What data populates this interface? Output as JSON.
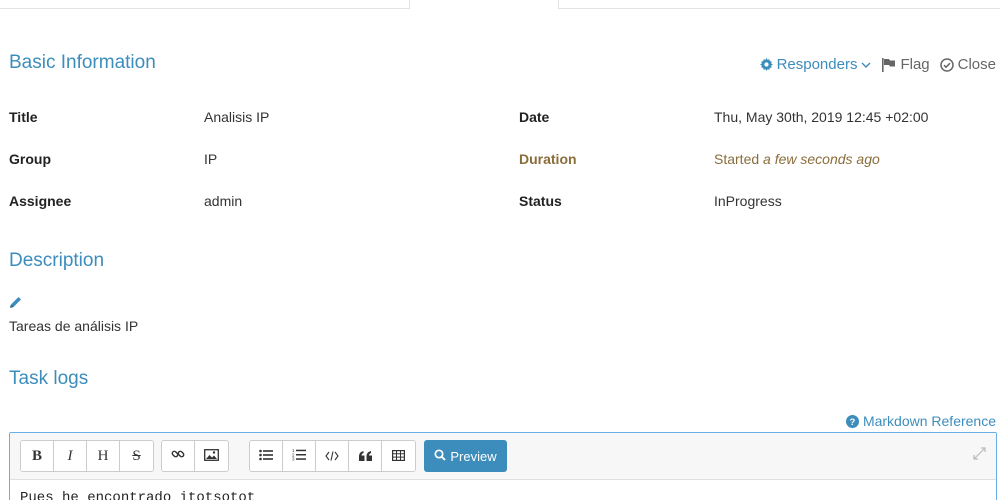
{
  "sections": {
    "basic_information": "Basic Information",
    "description": "Description",
    "task_logs": "Task logs"
  },
  "actions": {
    "responders": "Responders",
    "flag": "Flag",
    "close": "Close"
  },
  "fields": {
    "title_label": "Title",
    "title_value": "Analisis IP",
    "group_label": "Group",
    "group_value": "IP",
    "assignee_label": "Assignee",
    "assignee_value": "admin",
    "date_label": "Date",
    "date_value": "Thu, May 30th, 2019 12:45 +02:00",
    "duration_label": "Duration",
    "duration_prefix": "Started",
    "duration_value": "a few seconds ago",
    "status_label": "Status",
    "status_value": "InProgress"
  },
  "description": {
    "text": "Tareas de análisis IP"
  },
  "editor": {
    "markdown_reference": "Markdown Reference",
    "preview_label": "Preview",
    "toolbar": {
      "bold": "B",
      "italic": "I",
      "heading": "H",
      "strikethrough": "S"
    },
    "content": "Pues he encontrado itotsotot"
  },
  "colors": {
    "accent": "#3c8dbc",
    "warning_text": "#8a6d3b"
  }
}
